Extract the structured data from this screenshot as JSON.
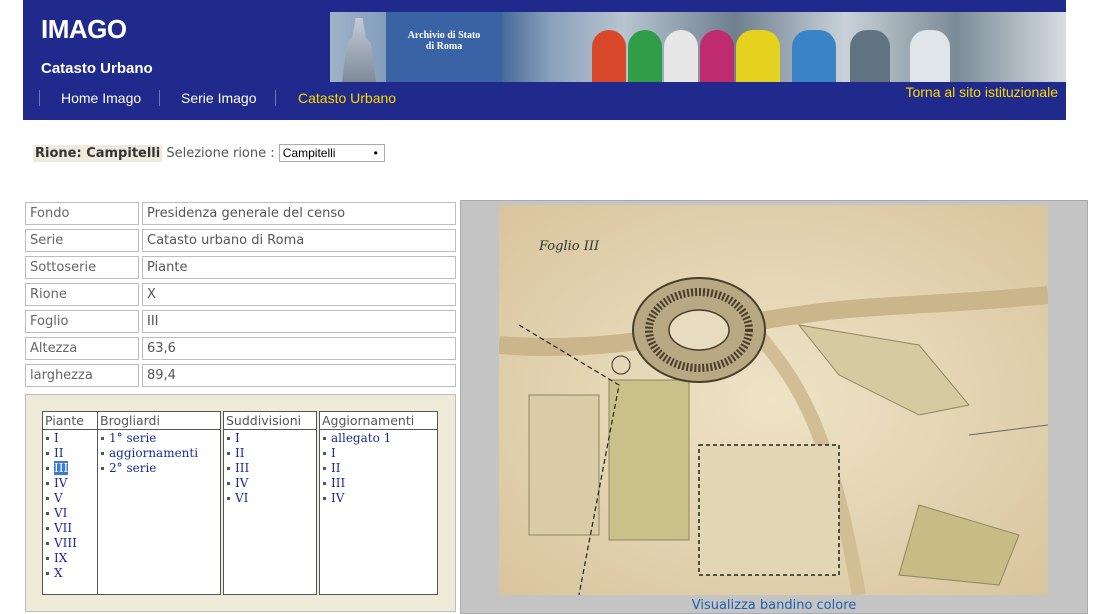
{
  "header": {
    "title": "IMAGO",
    "subtitle": "Catasto Urbano",
    "archive_line1": "Archivio di Stato",
    "archive_line2": "di Roma",
    "nav": [
      {
        "label": "Home Imago"
      },
      {
        "label": "Serie Imago"
      },
      {
        "label": "Catasto Urbano"
      }
    ],
    "return_link": "Torna al sito istituzionale",
    "colors": {
      "background": "#1f2a8c",
      "active_link": "#ffd800"
    }
  },
  "rione": {
    "label": "Rione: Campitelli",
    "select_label": "Selezione rione :",
    "selected": "Campitelli"
  },
  "metadata": [
    {
      "key": "Fondo",
      "value": "Presidenza generale del censo"
    },
    {
      "key": "Serie",
      "value": "Catasto urbano di Roma"
    },
    {
      "key": "Sottoserie",
      "value": "Piante"
    },
    {
      "key": "Rione",
      "value": "X"
    },
    {
      "key": "Foglio",
      "value": "III"
    },
    {
      "key": "Altezza",
      "value": "63,6"
    },
    {
      "key": "larghezza",
      "value": "89,4"
    }
  ],
  "lists": {
    "piante": {
      "header": "Piante",
      "items": [
        "I",
        "II",
        "III",
        "IV",
        "V",
        "VI",
        "VII",
        "VIII",
        "IX",
        "X"
      ],
      "selected": "III"
    },
    "brogliardi": {
      "header": "Brogliardi",
      "items": [
        "1° serie",
        "aggiornamenti",
        "2° serie"
      ]
    },
    "suddivisioni": {
      "header": "Suddivisioni",
      "items": [
        "I",
        "II",
        "III",
        "IV",
        "VI"
      ]
    },
    "aggiornamenti": {
      "header": "Aggiornamenti",
      "items": [
        "allegato 1",
        "I",
        "II",
        "III",
        "IV"
      ]
    }
  },
  "map": {
    "link": "Visualizza bandino colore",
    "sheet_label": "Foglio III"
  }
}
